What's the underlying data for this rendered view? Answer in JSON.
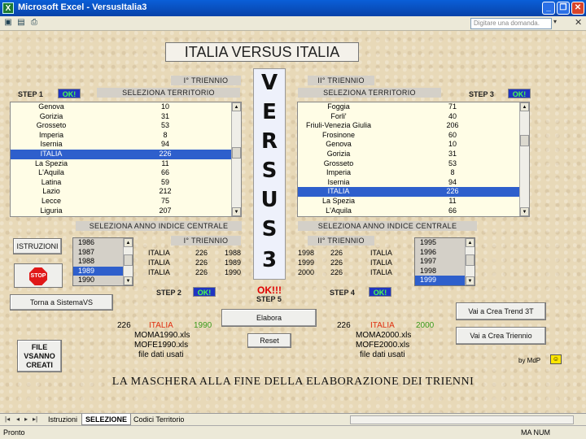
{
  "window": {
    "title": "Microsoft Excel - VersusItalia3",
    "ask_placeholder": "Digitare una domanda."
  },
  "sheet": {
    "main_title": "ITALIA VERSUS ITALIA",
    "versus_letters": [
      "V",
      "E",
      "R",
      "S",
      "U",
      "S",
      "3"
    ],
    "left": {
      "triennio_label": "I° TRIENNIO",
      "step1": "STEP 1",
      "step1_ok": "OK!",
      "territory_header": "SELEZIONA TERRITORIO",
      "territories": [
        {
          "name": "Genova",
          "value": "10"
        },
        {
          "name": "Gorizia",
          "value": "31"
        },
        {
          "name": "Grosseto",
          "value": "53"
        },
        {
          "name": "Imperia",
          "value": "8"
        },
        {
          "name": "Isernia",
          "value": "94"
        },
        {
          "name": "ITALIA",
          "value": "226",
          "selected": true
        },
        {
          "name": "La Spezia",
          "value": "11"
        },
        {
          "name": "L'Aquila",
          "value": "66"
        },
        {
          "name": "Latina",
          "value": "59"
        },
        {
          "name": "Lazio",
          "value": "212"
        },
        {
          "name": "Lecce",
          "value": "75"
        },
        {
          "name": "Liguria",
          "value": "207"
        }
      ],
      "year_header": "SELEZIONA ANNO INDICE CENTRALE",
      "years": [
        {
          "y": "1986"
        },
        {
          "y": "1987"
        },
        {
          "y": "1988"
        },
        {
          "y": "1989",
          "selected": true
        },
        {
          "y": "1990"
        }
      ],
      "triennio_label2": "I° TRIENNIO",
      "triennio_rows": [
        {
          "name": "ITALIA",
          "code": "226",
          "year": "1988"
        },
        {
          "name": "ITALIA",
          "code": "226",
          "year": "1989"
        },
        {
          "name": "ITALIA",
          "code": "226",
          "year": "1990"
        }
      ],
      "step2": "STEP 2",
      "step2_ok": "OK!",
      "summary": {
        "code": "226",
        "name": "ITALIA",
        "year": "1990"
      },
      "files": [
        "MOMA1990.xls",
        "MOFE1990.xls"
      ],
      "files_note": "file dati usati"
    },
    "right": {
      "triennio_label": "II° TRIENNIO",
      "step3": "STEP 3",
      "step3_ok": "OK!",
      "territory_header": "SELEZIONA TERRITORIO",
      "territories": [
        {
          "name": "Foggia",
          "value": "71"
        },
        {
          "name": "Forli'",
          "value": "40"
        },
        {
          "name": "Friuli-Venezia Giulia",
          "value": "206"
        },
        {
          "name": "Frosinone",
          "value": "60"
        },
        {
          "name": "Genova",
          "value": "10"
        },
        {
          "name": "Gorizia",
          "value": "31"
        },
        {
          "name": "Grosseto",
          "value": "53"
        },
        {
          "name": "Imperia",
          "value": "8"
        },
        {
          "name": "Isernia",
          "value": "94"
        },
        {
          "name": "ITALIA",
          "value": "226",
          "selected": true
        },
        {
          "name": "La Spezia",
          "value": "11"
        },
        {
          "name": "L'Aquila",
          "value": "66"
        }
      ],
      "year_header": "SELEZIONA ANNO INDICE CENTRALE",
      "years": [
        {
          "y": "1995"
        },
        {
          "y": "1996"
        },
        {
          "y": "1997"
        },
        {
          "y": "1998"
        },
        {
          "y": "1999",
          "selected": true
        }
      ],
      "triennio_label2": "II° TRIENNIO",
      "triennio_rows": [
        {
          "year": "1998",
          "code": "226",
          "name": "ITALIA"
        },
        {
          "year": "1999",
          "code": "226",
          "name": "ITALIA"
        },
        {
          "year": "2000",
          "code": "226",
          "name": "ITALIA"
        }
      ],
      "step4": "STEP 4",
      "step4_ok": "OK!",
      "summary": {
        "code": "226",
        "name": "ITALIA",
        "year": "2000"
      },
      "files": [
        "MOMA2000.xls",
        "MOFE2000.xls"
      ],
      "files_note": "file dati usati"
    },
    "step5_ok": "OK!!!",
    "step5": "STEP 5",
    "buttons": {
      "istruzioni": "ISTRUZIONI",
      "stop": "STOP",
      "torna": "Torna a SistemaVS",
      "file_line1": "FILE",
      "file_line2": "VSANNO",
      "file_line3": "CREATI",
      "elabora": "Elabora",
      "reset": "Reset",
      "crea_trend": "Vai a Crea Trend 3T",
      "crea_triennio": "Vai a Crea Triennio"
    },
    "byline": "by MdP",
    "caption": "LA MASCHERA ALLA FINE DELLA ELABORAZIONE DEI TRIENNI"
  },
  "tabs": [
    "Istruzioni",
    "SELEZIONE",
    "Codici Territorio"
  ],
  "active_tab": "SELEZIONE",
  "status": {
    "left": "Pronto",
    "right": "MA NUM"
  }
}
